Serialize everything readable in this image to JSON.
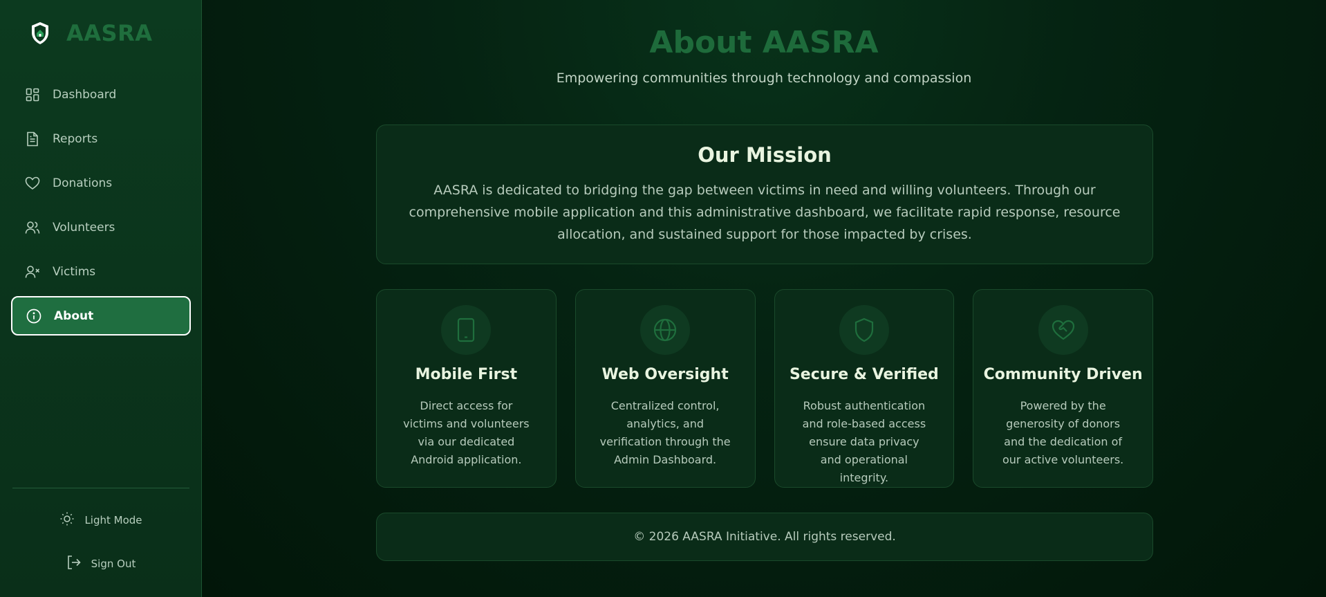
{
  "brand": {
    "name": "AASRA",
    "logo_icon": "shield-home-icon",
    "accent": "#1f6e3d"
  },
  "sidebar": {
    "items": [
      {
        "label": "Dashboard",
        "icon": "grid-icon",
        "active": false
      },
      {
        "label": "Reports",
        "icon": "document-icon",
        "active": false
      },
      {
        "label": "Donations",
        "icon": "heart-icon",
        "active": false
      },
      {
        "label": "Volunteers",
        "icon": "users-icon",
        "active": false
      },
      {
        "label": "Victims",
        "icon": "user-x-icon",
        "active": false
      },
      {
        "label": "About",
        "icon": "info-icon",
        "active": true
      }
    ],
    "light_mode_label": "Light Mode",
    "sign_out_label": "Sign Out"
  },
  "page": {
    "title": "About AASRA",
    "subtitle": "Empowering communities through technology and compassion"
  },
  "mission": {
    "title": "Our Mission",
    "text": "AASRA is dedicated to bridging the gap between victims in need and willing volunteers. Through our comprehensive mobile application and this administrative dashboard, we facilitate rapid response, resource allocation, and sustained support for those impacted by crises."
  },
  "features": [
    {
      "title": "Mobile First",
      "icon": "smartphone-icon",
      "text": "Direct access for victims and volunteers via our dedicated Android application."
    },
    {
      "title": "Web Oversight",
      "icon": "globe-icon",
      "text": "Centralized control, analytics, and verification through the Admin Dashboard."
    },
    {
      "title": "Secure & Verified",
      "icon": "shield-icon",
      "text": "Robust authentication and role-based access ensure data privacy and operational integrity."
    },
    {
      "title": "Community Driven",
      "icon": "heart-handshake-icon",
      "text": "Powered by the generosity of donors and the dedication of our active volunteers."
    }
  ],
  "footer": {
    "text": "© 2026 AASRA Initiative. All rights reserved."
  },
  "colors": {
    "background": "#03190e",
    "sidebar": "#0c3a1f",
    "card": "#0a2c18",
    "active_nav": "#1f6e40",
    "title_green": "#1e6b3b"
  }
}
